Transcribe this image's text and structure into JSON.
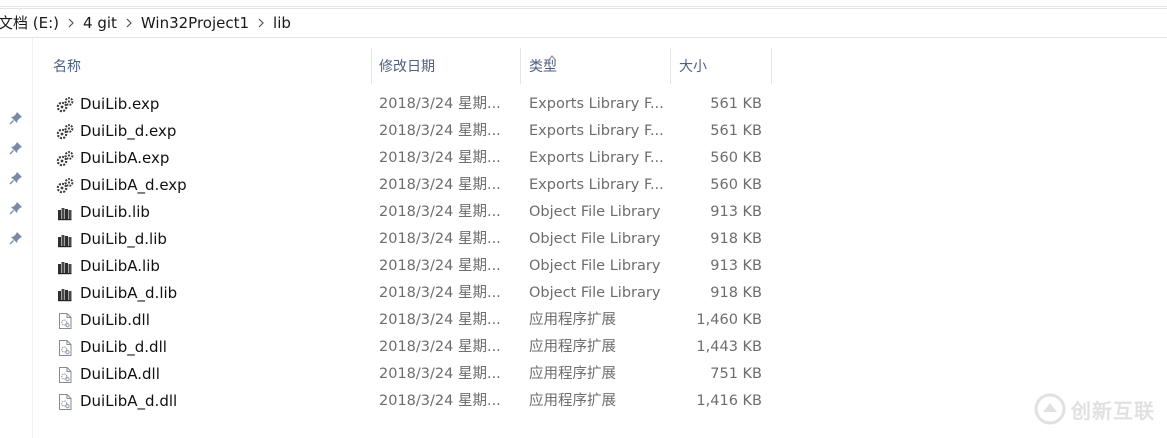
{
  "breadcrumb": [
    "文档 (E:)",
    "4 git",
    "Win32Project1",
    "lib"
  ],
  "columns": {
    "name": "名称",
    "date": "修改日期",
    "type": "类型",
    "size": "大小"
  },
  "files": [
    {
      "icon": "exp-file-icon",
      "name": "DuiLib.exp",
      "date": "2018/3/24 星期...",
      "type": "Exports Library F...",
      "size": "561 KB"
    },
    {
      "icon": "exp-file-icon",
      "name": "DuiLib_d.exp",
      "date": "2018/3/24 星期...",
      "type": "Exports Library F...",
      "size": "561 KB"
    },
    {
      "icon": "exp-file-icon",
      "name": "DuiLibA.exp",
      "date": "2018/3/24 星期...",
      "type": "Exports Library F...",
      "size": "560 KB"
    },
    {
      "icon": "exp-file-icon",
      "name": "DuiLibA_d.exp",
      "date": "2018/3/24 星期...",
      "type": "Exports Library F...",
      "size": "560 KB"
    },
    {
      "icon": "lib-file-icon",
      "name": "DuiLib.lib",
      "date": "2018/3/24 星期...",
      "type": "Object File Library",
      "size": "913 KB"
    },
    {
      "icon": "lib-file-icon",
      "name": "DuiLib_d.lib",
      "date": "2018/3/24 星期...",
      "type": "Object File Library",
      "size": "918 KB"
    },
    {
      "icon": "lib-file-icon",
      "name": "DuiLibA.lib",
      "date": "2018/3/24 星期...",
      "type": "Object File Library",
      "size": "913 KB"
    },
    {
      "icon": "lib-file-icon",
      "name": "DuiLibA_d.lib",
      "date": "2018/3/24 星期...",
      "type": "Object File Library",
      "size": "918 KB"
    },
    {
      "icon": "dll-file-icon",
      "name": "DuiLib.dll",
      "date": "2018/3/24 星期...",
      "type": "应用程序扩展",
      "size": "1,460 KB"
    },
    {
      "icon": "dll-file-icon",
      "name": "DuiLib_d.dll",
      "date": "2018/3/24 星期...",
      "type": "应用程序扩展",
      "size": "1,443 KB"
    },
    {
      "icon": "dll-file-icon",
      "name": "DuiLibA.dll",
      "date": "2018/3/24 星期...",
      "type": "应用程序扩展",
      "size": "751 KB"
    },
    {
      "icon": "dll-file-icon",
      "name": "DuiLibA_d.dll",
      "date": "2018/3/24 星期...",
      "type": "应用程序扩展",
      "size": "1,416 KB"
    }
  ],
  "watermark": {
    "text": "创新互联"
  },
  "colors": {
    "header_text": "#4d6082",
    "secondary_text": "#6d6d6d",
    "border": "#e5e5e5"
  }
}
